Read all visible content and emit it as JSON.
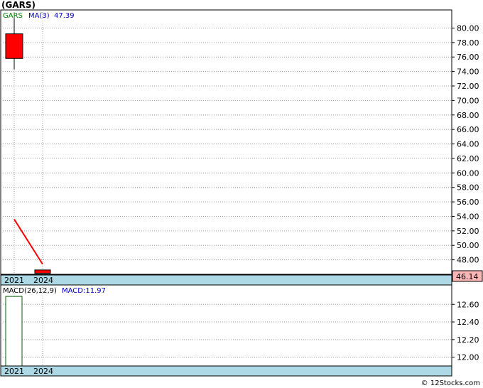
{
  "page": {
    "title": "(GARS)",
    "footer": "© 12Stocks.com"
  },
  "chart_data": [
    {
      "type": "candlestick",
      "name": "price",
      "legend": {
        "symbol": "GARS",
        "ma_label": "MA(3)",
        "ma_value": "47.39"
      },
      "categories": [
        "2021",
        "2024"
      ],
      "candles": [
        {
          "x": "2021",
          "open": 79.2,
          "high": 81.4,
          "low": 74.3,
          "close": 75.8
        },
        {
          "x": "2024",
          "open": 46.6,
          "high": 46.6,
          "low": 46.1,
          "close": 46.14
        }
      ],
      "moving_average": {
        "label": "MA(3)",
        "values": [
          53.6,
          47.4
        ]
      },
      "ylim": [
        46.0,
        82.5
      ],
      "y_ticks": [
        48,
        50,
        52,
        54,
        56,
        58,
        60,
        62,
        64,
        66,
        68,
        70,
        72,
        74,
        76,
        78,
        80
      ],
      "y_tick_labels": [
        "48.00",
        "50.00",
        "52.00",
        "54.00",
        "56.00",
        "58.00",
        "60.00",
        "62.00",
        "64.00",
        "66.00",
        "68.00",
        "70.00",
        "72.00",
        "74.00",
        "76.00",
        "78.00",
        "80.00"
      ],
      "last_price": "46.14",
      "grid": true,
      "colors": {
        "candle": "#ff0000",
        "ma": "#ff0000",
        "symbol": "#008000",
        "ma_text": "#0000c0",
        "axis_band": "#add8e6",
        "last_price_bg": "#ffb6b6"
      }
    },
    {
      "type": "bar",
      "name": "macd",
      "legend": {
        "label": "MACD(26,12,9)",
        "value_label": "MACD:11.97"
      },
      "categories": [
        "2021",
        "2024"
      ],
      "values": [
        12.69,
        11.97
      ],
      "ylim": [
        11.9,
        12.82
      ],
      "y_ticks": [
        12.0,
        12.2,
        12.4,
        12.6
      ],
      "y_tick_labels": [
        "12.00",
        "12.20",
        "12.40",
        "12.60"
      ],
      "grid": true,
      "colors": {
        "bar_outline": "#006400",
        "value_text": "#0000c0"
      }
    }
  ]
}
